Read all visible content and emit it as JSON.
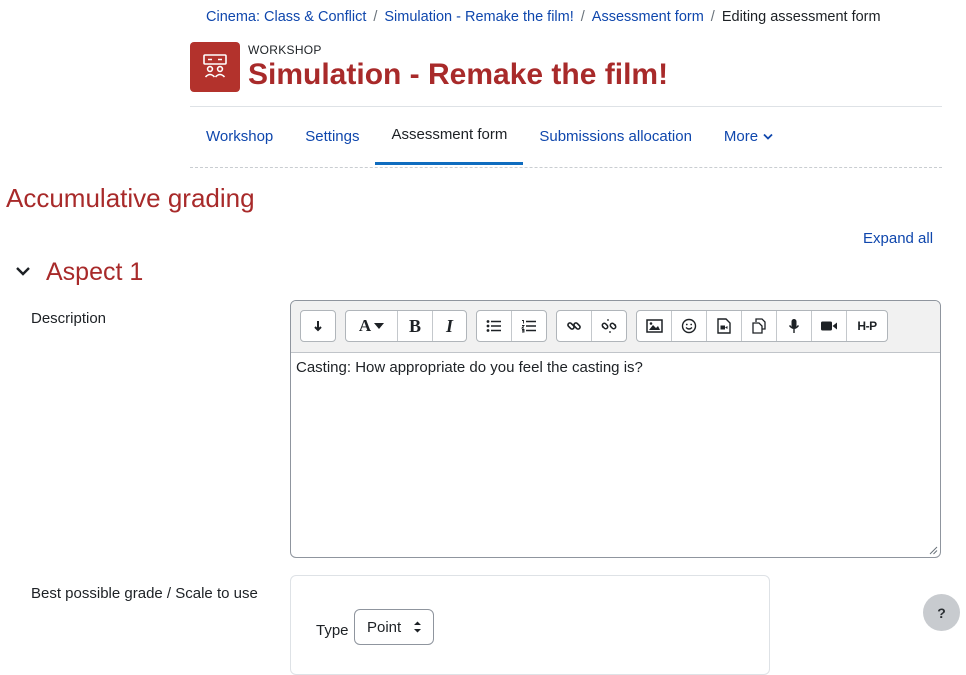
{
  "breadcrumb": [
    {
      "label": "Cinema: Class & Conflict"
    },
    {
      "label": "Simulation - Remake the film!"
    },
    {
      "label": "Assessment form"
    },
    {
      "label": "Editing assessment form"
    }
  ],
  "breadcrumb_separator": "/",
  "module": {
    "type_label": "WORKSHOP",
    "title": "Simulation - Remake the film!",
    "icon": "workshop-icon",
    "icon_color": "#b3322c"
  },
  "nav": {
    "tabs": [
      {
        "label": "Workshop"
      },
      {
        "label": "Settings"
      },
      {
        "label": "Assessment form",
        "active": true
      },
      {
        "label": "Submissions allocation"
      },
      {
        "label": "More"
      }
    ]
  },
  "section": {
    "heading": "Accumulative grading",
    "expand_all": "Expand all"
  },
  "aspect": {
    "title": "Aspect 1",
    "description_label": "Description",
    "description_text": "Casting: How appropriate do you feel the casting is?"
  },
  "editor": {
    "toolbar_icons": [
      "collapse-icon",
      "font-color-icon",
      "bold-icon",
      "italic-icon",
      "bullet-list-icon",
      "numbered-list-icon",
      "link-icon",
      "unlink-icon",
      "image-icon",
      "emoji-icon",
      "media-icon",
      "manage-files-icon",
      "record-audio-icon",
      "record-video-icon",
      "h5p-icon"
    ],
    "font_glyph": "A",
    "bold_glyph": "B",
    "italic_glyph": "I",
    "h5p_glyph": "H-P"
  },
  "grade": {
    "label": "Best possible grade / Scale to use",
    "type_label": "Type",
    "type_value": "Point"
  },
  "help_button": "?",
  "colors": {
    "accent": "#a82a2a",
    "link": "#0f47ad",
    "active_tab": "#0f6cbf"
  }
}
